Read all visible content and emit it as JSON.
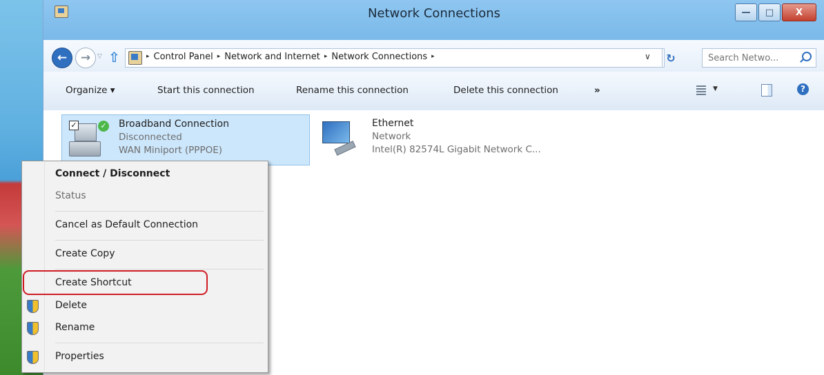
{
  "window": {
    "title": "Network Connections",
    "min_glyph": "—",
    "max_glyph": "□",
    "close_glyph": "X"
  },
  "address": {
    "breadcrumbs": [
      "Control Panel",
      "Network and Internet",
      "Network Connections"
    ],
    "separator": "▸",
    "search_placeholder": "Search Netwo...",
    "back_glyph": "←",
    "forward_glyph": "→",
    "history_glyph": "▽",
    "up_glyph": "⇧",
    "dropdown_glyph": "∨",
    "refresh_glyph": "↻"
  },
  "toolbar": {
    "organize": "Organize ▾",
    "start": "Start this connection",
    "rename": "Rename this connection",
    "delete": "Delete this connection",
    "more": "»",
    "view_dropdown": "▼",
    "help_glyph": "?"
  },
  "connections": [
    {
      "name": "Broadband Connection",
      "status": "Disconnected",
      "device": "WAN Miniport (PPPOE)",
      "checkbox": "✓",
      "badge": "✓"
    },
    {
      "name": "Ethernet",
      "status": "Network",
      "device": "Intel(R) 82574L Gigabit Network C..."
    }
  ],
  "context_menu": {
    "connect": "Connect / Disconnect",
    "status": "Status",
    "cancel_default": "Cancel as Default Connection",
    "create_copy": "Create Copy",
    "create_shortcut": "Create Shortcut",
    "delete": "Delete",
    "rename": "Rename",
    "properties": "Properties"
  },
  "colors": {
    "selection": "#cce6fb",
    "highlight_ring": "#cf1c24",
    "titlebar": "#8ec6f0"
  }
}
